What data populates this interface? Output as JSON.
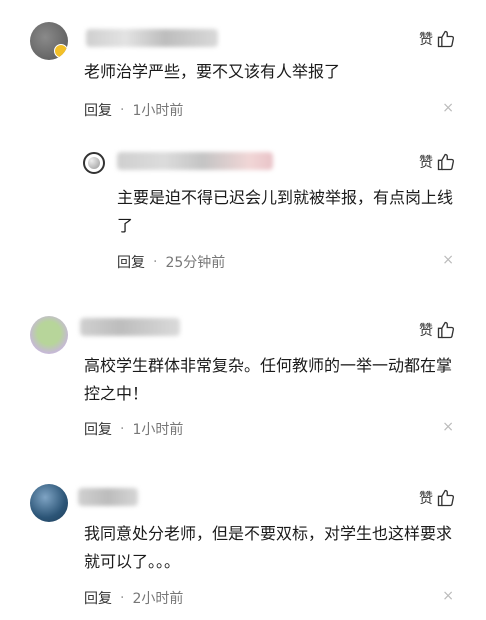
{
  "like_label": "赞",
  "reply_label": "回复",
  "dot": "·",
  "close_glyph": "×",
  "comments": [
    {
      "text": "老师治学严些，要不又该有人举报了",
      "time": "1小时前"
    },
    {
      "text": "主要是迫不得已迟会儿到就被举报，有点岗上线了",
      "time": "25分钟前"
    },
    {
      "text": "高校学生群体非常复杂。任何教师的一举一动都在掌控之中！",
      "time": "1小时前"
    },
    {
      "text": "我同意处分老师，但是不要双标，对学生也这样要求就可以了。。。",
      "time": "2小时前"
    }
  ]
}
